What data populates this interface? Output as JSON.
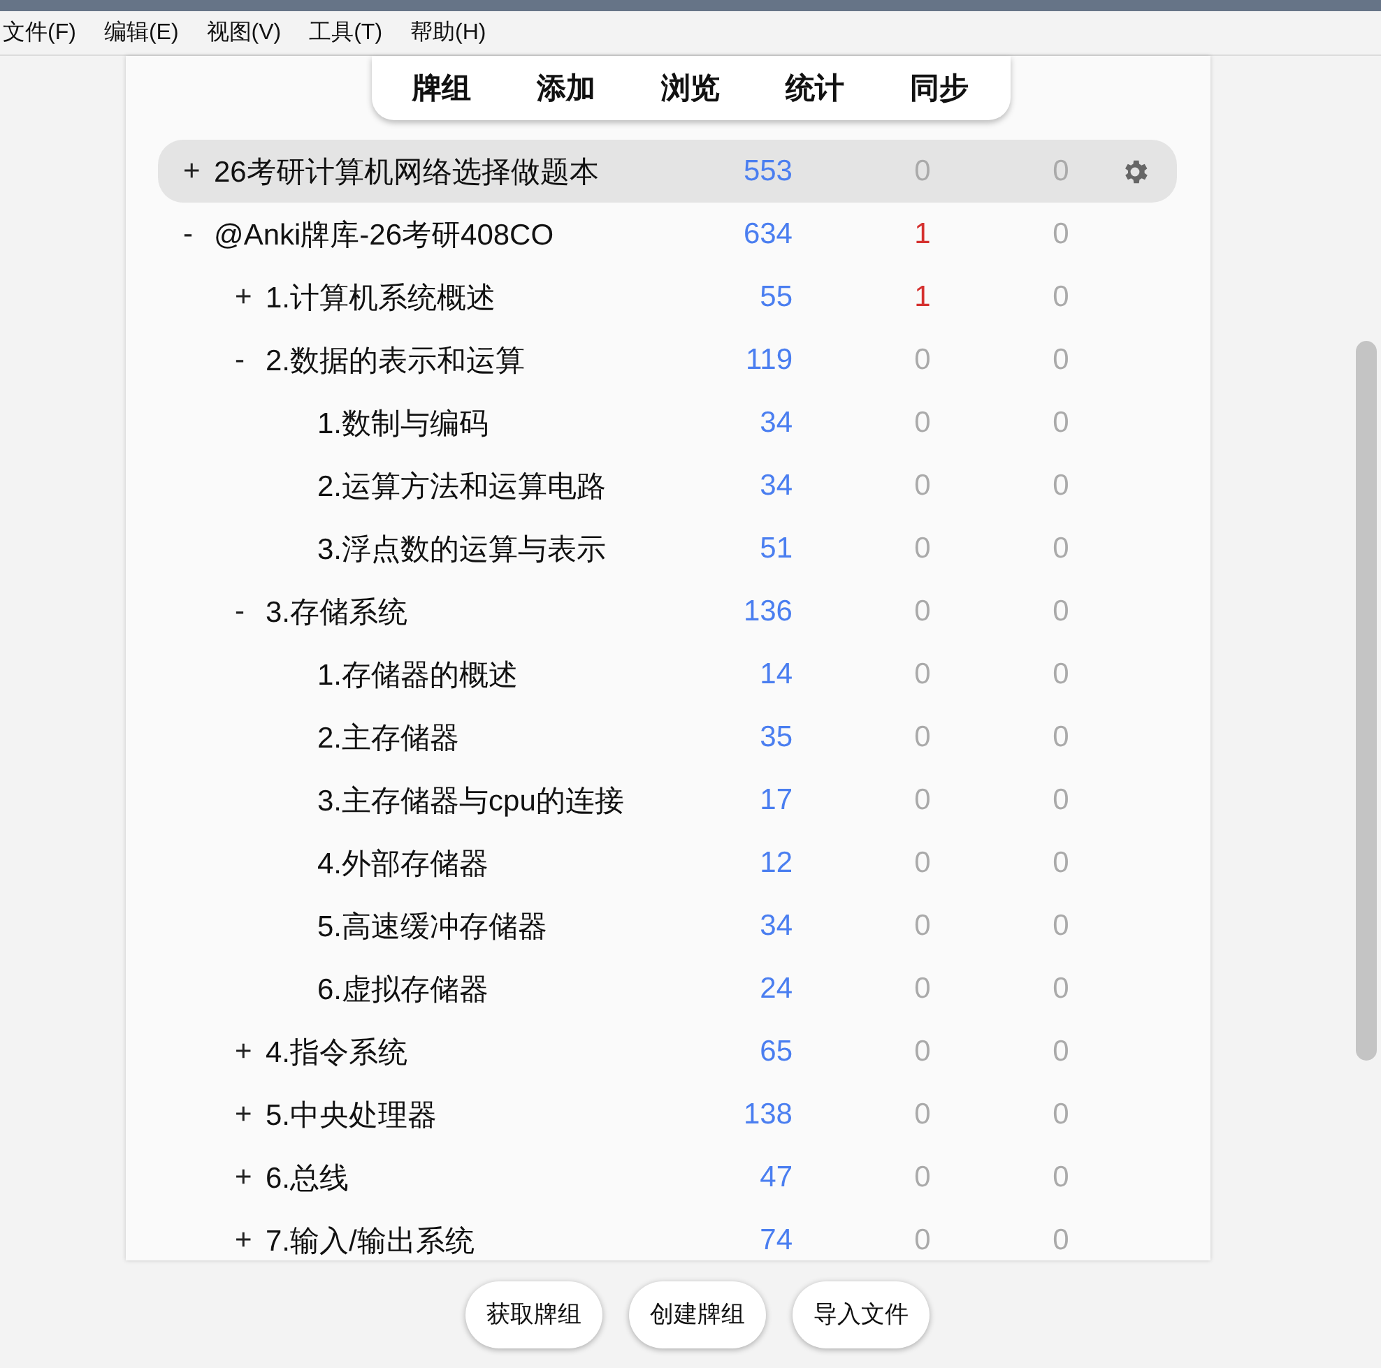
{
  "menu": [
    "文件(F)",
    "编辑(E)",
    "视图(V)",
    "工具(T)",
    "帮助(H)"
  ],
  "toolbar": [
    "牌组",
    "添加",
    "浏览",
    "统计",
    "同步"
  ],
  "decks": [
    {
      "name": "26考研计算机网络选择做题本",
      "new": "553",
      "learn_active": false,
      "learn_text": "0",
      "due": "0",
      "toggle": "+",
      "selected": true
    },
    {
      "name": "@Anki牌库-26考研408CO",
      "new": "634",
      "learn_text": "1",
      "learn_active": true,
      "due": "0",
      "toggle": "-",
      "expanded": true,
      "selected": false,
      "children": [
        {
          "name": "1.计算机系统概述",
          "new": "55",
          "learn_text": "1",
          "learn_active": true,
          "due": "0",
          "toggle": "+",
          "expanded": false,
          "selected": false
        },
        {
          "name": "2.数据的表示和运算",
          "new": "119",
          "learn_text": "0",
          "learn_active": false,
          "due": "0",
          "toggle": "-",
          "expanded": true,
          "selected": false,
          "children": [
            {
              "name": "1.数制与编码",
              "new": "34",
              "learn_text": "0",
              "learn_active": false,
              "due": "0",
              "selected": false
            },
            {
              "name": "2.运算方法和运算电路",
              "new": "34",
              "learn_text": "0",
              "learn_active": false,
              "due": "0",
              "selected": false
            },
            {
              "name": "3.浮点数的运算与表示",
              "new": "51",
              "learn_text": "0",
              "learn_active": false,
              "due": "0",
              "selected": false
            }
          ]
        },
        {
          "name": "3.存储系统",
          "new": "136",
          "learn_text": "0",
          "learn_active": false,
          "due": "0",
          "toggle": "-",
          "expanded": true,
          "selected": false,
          "children": [
            {
              "name": "1.存储器的概述",
              "new": "14",
              "learn_text": "0",
              "learn_active": false,
              "due": "0",
              "selected": false
            },
            {
              "name": "2.主存储器",
              "new": "35",
              "learn_text": "0",
              "learn_active": false,
              "due": "0",
              "selected": false
            },
            {
              "name": "3.主存储器与cpu的连接",
              "new": "17",
              "learn_text": "0",
              "learn_active": false,
              "due": "0",
              "selected": false
            },
            {
              "name": "4.外部存储器",
              "new": "12",
              "learn_text": "0",
              "learn_active": false,
              "due": "0",
              "selected": false
            },
            {
              "name": "5.高速缓冲存储器",
              "new": "34",
              "learn_text": "0",
              "learn_active": false,
              "due": "0",
              "selected": false
            },
            {
              "name": "6.虚拟存储器",
              "new": "24",
              "learn_text": "0",
              "learn_active": false,
              "due": "0",
              "selected": false
            }
          ]
        },
        {
          "name": "4.指令系统",
          "new": "65",
          "learn_text": "0",
          "learn_active": false,
          "due": "0",
          "toggle": "+",
          "expanded": false,
          "selected": false
        },
        {
          "name": "5.中央处理器",
          "new": "138",
          "learn_text": "0",
          "learn_active": false,
          "due": "0",
          "toggle": "+",
          "expanded": false,
          "selected": false
        },
        {
          "name": "6.总线",
          "new": "47",
          "learn_text": "0",
          "learn_active": false,
          "due": "0",
          "toggle": "+",
          "expanded": false,
          "selected": false
        },
        {
          "name": "7.输入/输出系统",
          "new": "74",
          "learn_text": "0",
          "learn_active": false,
          "due": "0",
          "toggle": "+",
          "expanded": false,
          "selected": false
        }
      ]
    }
  ],
  "buttons": [
    "获取牌组",
    "创建牌组",
    "导入文件"
  ]
}
